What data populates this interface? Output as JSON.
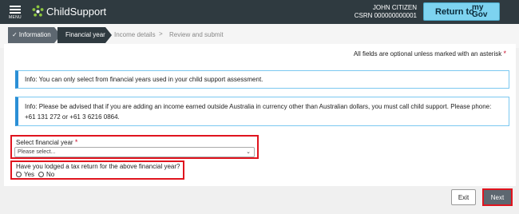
{
  "header": {
    "menu_label": "MENU",
    "app_name": "ChildSupport",
    "user_name": "JOHN CITIZEN",
    "csrn": "CSRN 000000000001",
    "return_label": "Return to",
    "mygov_line1": "my",
    "mygov_line2": "Gov"
  },
  "steps": {
    "completed": "Information",
    "current": "Financial year",
    "upcoming": [
      "Income details",
      "Review and submit"
    ],
    "separator": ">"
  },
  "form": {
    "required_note": "All fields are optional unless marked with an asterisk",
    "asterisk": "*",
    "info1": "Info: You can only select from financial years used in your child support assessment.",
    "info2": "Info: Please be advised that if you are adding an income earned outside Australia in currency other than Australian dollars, you must call child support. Please phone: +61 131 272 or +61 3 6216 0864.",
    "fy_label": "Select financial year",
    "fy_placeholder": "Please select...",
    "tax_label": "Have you lodged a tax return for the above financial year?",
    "options": [
      "Yes",
      "No"
    ]
  },
  "footer": {
    "exit_label": "Exit",
    "next_label": "Next"
  },
  "colors": {
    "header_bg": "#2f3a40",
    "mygov_btn": "#7dd3f0",
    "info_border": "#2b8fd6",
    "highlight": "#e0141e",
    "next_bg": "#5d6770"
  }
}
